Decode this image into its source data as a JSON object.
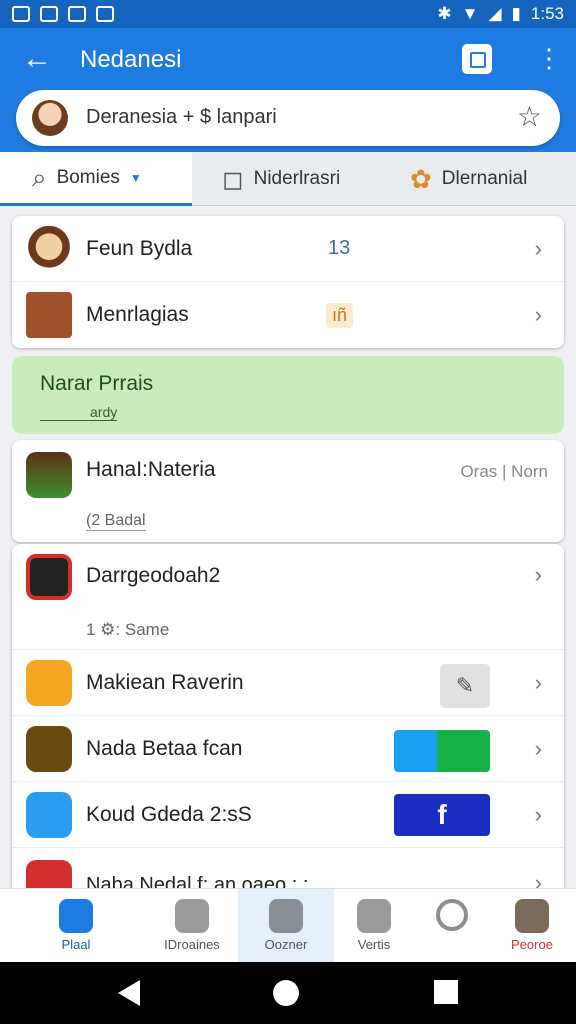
{
  "status": {
    "time": "1:53"
  },
  "appbar": {
    "title": "Nedanesi",
    "search_text": "Deranesia + $ lanpari"
  },
  "tabs": [
    {
      "label": "Bomies"
    },
    {
      "label": "Niderlrasri"
    },
    {
      "label": "Dlernanial"
    }
  ],
  "top_list": [
    {
      "title": "Feun Bydla",
      "value": "13"
    },
    {
      "title": "Menrlagias",
      "value": "ıñ"
    }
  ],
  "banner": {
    "title": "Narar Prrais",
    "subtitle": "ardy"
  },
  "featured": {
    "title": "HanaI:Nateria",
    "meta": "Oras | Norn",
    "sub": "(2 Badal"
  },
  "apps": [
    {
      "title": "Darrgeodoah2",
      "sub": "1 ⚙: Same"
    },
    {
      "title": "Makiean Raverin"
    },
    {
      "title": "Nada Betaa fcan"
    },
    {
      "title": "Koud Gdeda 2:sS"
    },
    {
      "title": "Naba Nedal  f: an  oaeo  : :"
    }
  ],
  "bottom_nav": [
    {
      "label": "Plaal"
    },
    {
      "label": "IDroaines"
    },
    {
      "label": "Oozner"
    },
    {
      "label": "Vertis"
    },
    {
      "label": ""
    },
    {
      "label": "Peoroe"
    }
  ],
  "colors": {
    "primary": "#1e7be0",
    "banner": "#c8ebc0",
    "accent_red": "#d32f2f"
  }
}
